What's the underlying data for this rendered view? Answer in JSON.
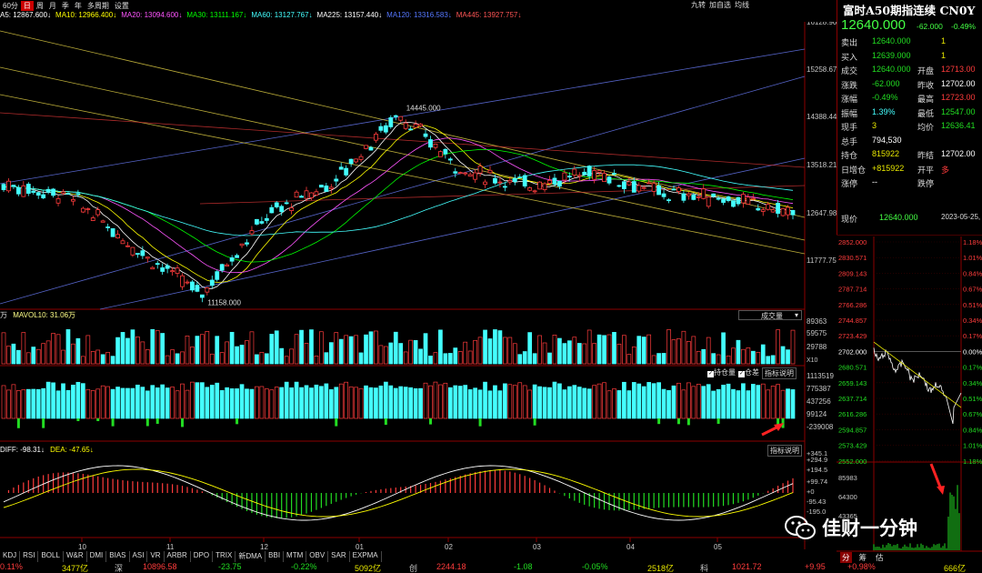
{
  "toolbar": {
    "periods": [
      "60分",
      "日",
      "周",
      "月",
      "季",
      "年",
      "多周期",
      "设置"
    ],
    "active_period": "日",
    "right_buttons": [
      "九转",
      "加自选",
      "均线"
    ]
  },
  "ma_legend": {
    "items": [
      {
        "text": "A5: 12867.600↓",
        "color": "#ffffff"
      },
      {
        "text": "MA10: 12966.400↓",
        "color": "#ffff00"
      },
      {
        "text": "MA20: 13094.600↓",
        "color": "#ff55ff"
      },
      {
        "text": "MA30: 13111.167↓",
        "color": "#00ff00"
      },
      {
        "text": "MA60: 13127.767↓",
        "color": "#44ffff"
      },
      {
        "text": "MA225: 13157.440↓",
        "color": "#ffffff"
      },
      {
        "text": "MA120: 13316.583↓",
        "color": "#5577ff"
      },
      {
        "text": "MA445: 13927.757↓",
        "color": "#ff5555"
      }
    ]
  },
  "price_axis": [
    "16128.90",
    "15258.67",
    "14388.44",
    "13518.21",
    "12647.98",
    "11777.75"
  ],
  "price_annotations": {
    "high": "14445.000",
    "low": "11158.000"
  },
  "volume_pane": {
    "legend": "MAVOL10: 31.06万",
    "unit": "万",
    "selector": "成交量",
    "axis": [
      "89363",
      "59575",
      "29788"
    ],
    "axis_mult": "X10"
  },
  "oi_pane": {
    "check1": "持仓量",
    "check2": "仓差",
    "help": "指标说明",
    "axis": [
      "1113519",
      "775387",
      "437256",
      "99124",
      "-239008"
    ]
  },
  "macd_pane": {
    "legend_diff": "DIFF: -98.31↓",
    "legend_dea": "DEA: -47.65↓",
    "help": "指标说明",
    "axis": [
      "+345.1",
      "+294.9",
      "+194.5",
      "+99.74",
      "+0",
      "-95.43",
      "-195.0"
    ]
  },
  "month_axis": [
    "10",
    "11",
    "12",
    "01",
    "02",
    "03",
    "04",
    "05"
  ],
  "indicator_tabs": [
    "KDJ",
    "RSI",
    "BOLL",
    "W&R",
    "DMI",
    "BIAS",
    "ASI",
    "VR",
    "ARBR",
    "DPO",
    "TRIX",
    "新DMA",
    "BBI",
    "MTM",
    "OBV",
    "SAR",
    "EXPMA"
  ],
  "status_bar": [
    {
      "text": "0.11%",
      "color": "#ff3c3c"
    },
    {
      "text": "3477亿",
      "color": "#e8e800"
    },
    {
      "text": "深",
      "color": "#c8c8c8"
    },
    {
      "text": "10896.58",
      "color": "#ff3c3c"
    },
    {
      "text": "-23.75",
      "color": "#22dd22"
    },
    {
      "text": "-0.22%",
      "color": "#22dd22"
    },
    {
      "text": "5092亿",
      "color": "#e8e800"
    },
    {
      "text": "创",
      "color": "#c8c8c8"
    },
    {
      "text": "2244.18",
      "color": "#ff3c3c"
    },
    {
      "text": "-1.08",
      "color": "#22dd22"
    },
    {
      "text": "-0.05%",
      "color": "#22dd22"
    },
    {
      "text": "2518亿",
      "color": "#e8e800"
    },
    {
      "text": "科",
      "color": "#c8c8c8"
    },
    {
      "text": "1021.72",
      "color": "#ff3c3c"
    },
    {
      "text": "+9.95",
      "color": "#ff3c3c"
    },
    {
      "text": "+0.98%",
      "color": "#ff3c3c"
    },
    {
      "text": "666亿",
      "color": "#e8e800"
    }
  ],
  "quote": {
    "title": "富时A50期指连续 CN0Y",
    "price": "12640.000",
    "change": "-62.000",
    "change_pct": "-0.49%",
    "rows": [
      {
        "l1": "卖出",
        "v1": "12640.000",
        "c1": "#22dd22",
        "l2": "",
        "v2": "1",
        "c2": "#e8e800"
      },
      {
        "l1": "买入",
        "v1": "12639.000",
        "c1": "#22dd22",
        "l2": "",
        "v2": "1",
        "c2": "#e8e800"
      },
      {
        "l1": "成交",
        "v1": "12640.000",
        "c1": "#22dd22",
        "l2": "开盘",
        "v2": "12713.00",
        "c2": "#ff3c3c"
      },
      {
        "l1": "涨跌",
        "v1": "-62.000",
        "c1": "#22dd22",
        "l2": "昨收",
        "v2": "12702.00",
        "c2": "#ffffff"
      },
      {
        "l1": "涨幅",
        "v1": "-0.49%",
        "c1": "#22dd22",
        "l2": "最高",
        "v2": "12723.00",
        "c2": "#ff3c3c"
      },
      {
        "l1": "振幅",
        "v1": "1.39%",
        "c1": "#44ffff",
        "l2": "最低",
        "v2": "12547.00",
        "c2": "#22dd22"
      },
      {
        "l1": "现手",
        "v1": "3",
        "c1": "#e8e800",
        "l2": "均价",
        "v2": "12636.41",
        "c2": "#22dd22"
      },
      {
        "l1": "总手",
        "v1": "794,530",
        "c1": "#ffffff",
        "l2": "",
        "v2": "",
        "c2": "#ffffff"
      },
      {
        "l1": "持仓",
        "v1": "815922",
        "c1": "#e8e800",
        "l2": "昨结",
        "v2": "12702.00",
        "c2": "#ffffff"
      },
      {
        "l1": "日增仓",
        "v1": "+815922",
        "c1": "#e8e800",
        "l2": "开平",
        "v2": "多",
        "c2": "#ff3c3c"
      },
      {
        "l1": "涨停",
        "v1": "--",
        "c1": "#ffffff",
        "l2": "跌停",
        "v2": "",
        "c2": "#ffffff"
      }
    ],
    "now_label": "现价",
    "now_price": "12640.000",
    "date": "2023-05-25,"
  },
  "intraday": {
    "left_axis": [
      "2852.000",
      "2830.571",
      "2809.143",
      "2787.714",
      "2766.286",
      "2744.857",
      "2723.429",
      "2702.000",
      "2680.571",
      "2659.143",
      "2637.714",
      "2616.286",
      "2594.857",
      "2573.429",
      "2552.000"
    ],
    "right_axis": [
      "1.18%",
      "1.01%",
      "0.84%",
      "0.67%",
      "0.51%",
      "0.34%",
      "0.17%",
      "0.00%",
      "0.17%",
      "0.34%",
      "0.51%",
      "0.67%",
      "0.84%",
      "1.01%",
      "1.18%"
    ],
    "vol_axis": [
      "85983",
      "64300",
      "43365"
    ],
    "tabs": [
      "分",
      "筹",
      "估"
    ]
  },
  "watermark": "佳财一分钟",
  "chart_data": {
    "type": "candlestick",
    "title": "",
    "xlabel": "",
    "ylabel": "",
    "x": [
      "10",
      "11",
      "12",
      "01",
      "02",
      "03",
      "04",
      "05"
    ],
    "ylim": [
      11777.75,
      16128.9
    ],
    "series": [
      {
        "name": "close",
        "values": [
          13150,
          12950,
          12000,
          11158,
          12600,
          13200,
          14445,
          13400,
          13150,
          13400,
          13000,
          12900,
          12640
        ]
      }
    ],
    "annotations": [
      "14445.000",
      "11158.000"
    ],
    "grid": false
  }
}
